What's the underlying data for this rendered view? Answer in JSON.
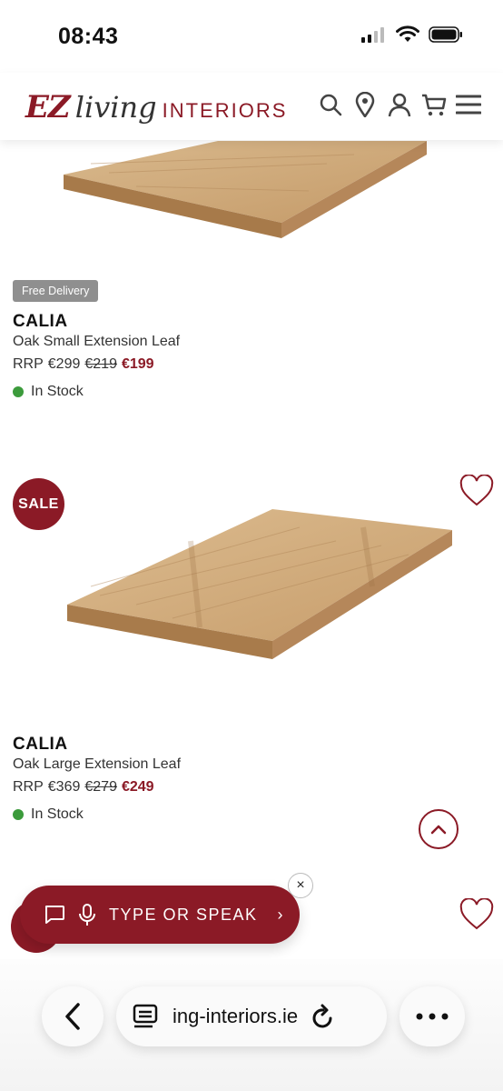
{
  "status_bar": {
    "time": "08:43"
  },
  "header": {
    "logo_ez": "EZ",
    "logo_living": "living",
    "logo_interiors": "INTERIORS",
    "icons": [
      "search-icon",
      "location-pin-icon",
      "account-icon",
      "cart-icon",
      "menu-icon"
    ]
  },
  "products": [
    {
      "badge": "Free Delivery",
      "brand": "CALIA",
      "name": "Oak Small Extension Leaf",
      "rrp_label": "RRP",
      "rrp": "€299",
      "was": "€219",
      "now": "€199",
      "stock": "In Stock"
    },
    {
      "sale_badge": "SALE",
      "brand": "CALIA",
      "name": "Oak Large Extension Leaf",
      "rrp_label": "RRP",
      "rrp": "€369",
      "was": "€279",
      "now": "€249",
      "stock": "In Stock"
    }
  ],
  "assistant": {
    "label": "TYPE OR SPEAK",
    "chevron": "›",
    "close": "×"
  },
  "browser": {
    "url": "ing-interiors.ie"
  },
  "colors": {
    "brand": "#8b1a26",
    "in_stock": "#3c9b3c",
    "badge_grey": "#8f8f8f"
  }
}
